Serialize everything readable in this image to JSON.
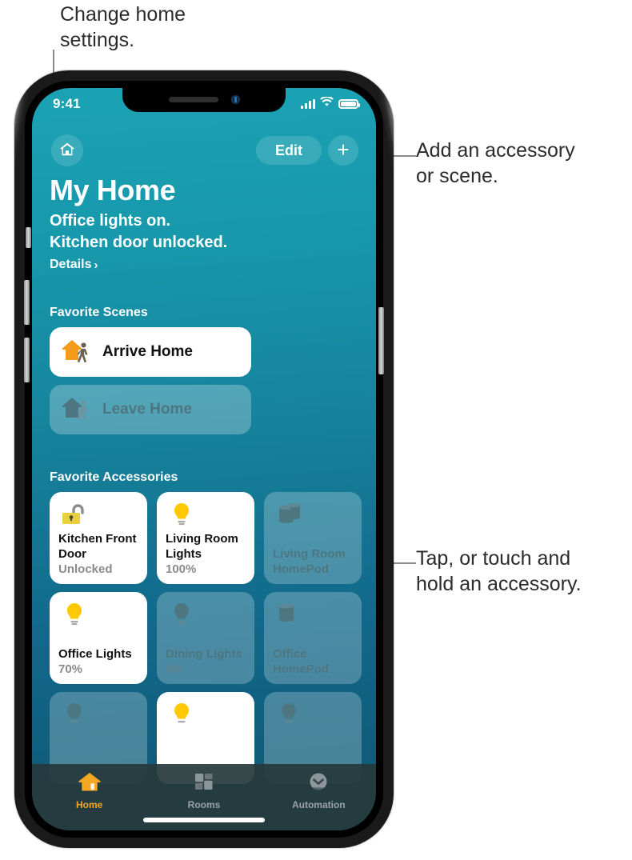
{
  "callouts": [
    {
      "id": "settings",
      "text": "Change home\nsettings."
    },
    {
      "id": "add",
      "text": "Add an accessory\nor scene."
    },
    {
      "id": "tap",
      "text": "Tap, or touch and\nhold an accessory."
    }
  ],
  "status_bar": {
    "time": "9:41",
    "cellular_icon": "signal-bars-icon",
    "wifi_icon": "wifi-icon",
    "battery_icon": "battery-full-icon"
  },
  "nav": {
    "home_settings_icon": "house-icon",
    "edit_label": "Edit",
    "add_label": "+"
  },
  "header": {
    "title": "My Home",
    "status_line_1": "Office lights on.",
    "status_line_2": "Kitchen door unlocked.",
    "details_label": "Details",
    "details_chevron": "›"
  },
  "sections": {
    "scenes_title": "Favorite Scenes",
    "accessories_title": "Favorite Accessories"
  },
  "scenes": [
    {
      "label": "Arrive Home",
      "icon": "house-arrive-icon",
      "state": "on"
    },
    {
      "label": "Leave Home",
      "icon": "house-leave-icon",
      "state": "off"
    }
  ],
  "accessories": [
    {
      "name": "Kitchen\nFront Door",
      "state": "Unlocked",
      "icon": "unlocked-padlock-icon",
      "tile": "on",
      "alert": true
    },
    {
      "name": "Living Room\nLights",
      "state": "100%",
      "icon": "lightbulb-icon",
      "tile": "on",
      "alert": false
    },
    {
      "name": "Living Room\nHomePod",
      "state": "",
      "icon": "homepod-stereo-icon",
      "tile": "off",
      "alert": false
    },
    {
      "name": "Office\nLights",
      "state": "70%",
      "icon": "lightbulb-icon",
      "tile": "on",
      "alert": false
    },
    {
      "name": "Dining\nLights",
      "state": "Off",
      "icon": "lightbulb-icon",
      "tile": "off",
      "alert": false
    },
    {
      "name": "Office\nHomePod",
      "state": "",
      "icon": "homepod-icon",
      "tile": "off",
      "alert": false
    }
  ],
  "accessories_row3": [
    {
      "name": "",
      "state": "",
      "icon": "lightbulb-icon",
      "tile": "off"
    },
    {
      "name": "",
      "state": "",
      "icon": "lightbulb-icon",
      "tile": "on"
    },
    {
      "name": "",
      "state": "",
      "icon": "lightbulb-icon",
      "tile": "off"
    }
  ],
  "tabs": [
    {
      "label": "Home",
      "icon": "house-filled-icon",
      "active": true
    },
    {
      "label": "Rooms",
      "icon": "rooms-grid-icon",
      "active": false
    },
    {
      "label": "Automation",
      "icon": "clock-icon",
      "active": false
    }
  ],
  "colors": {
    "background_top": "#1aa3b4",
    "background_bottom": "#0e5671",
    "accent_orange": "#f5a623",
    "alert_red": "#ff2d20",
    "lock_yellow": "#e9cf3e",
    "bulb_yellow": "#ffc800",
    "tabbar": "#26383c"
  }
}
